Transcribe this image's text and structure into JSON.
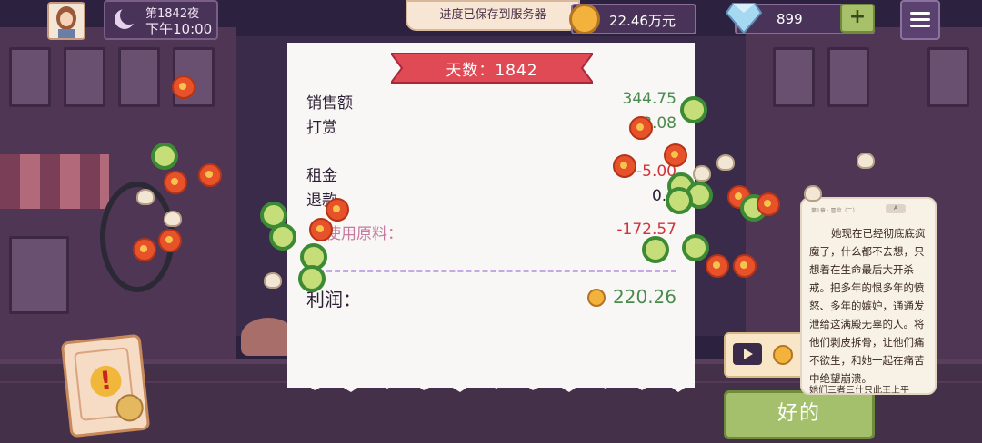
{
  "hud": {
    "day": "第1842夜",
    "time": "下午10:00",
    "save_toast": "进度已保存到服务器",
    "money": "22.46万元",
    "gems": "899",
    "plus": "+"
  },
  "receipt": {
    "banner": "天数：1842",
    "rows": [
      {
        "label": "销售额",
        "value": "344.75"
      },
      {
        "label": "打赏",
        "value": "8.08"
      },
      {
        "label": "租金",
        "value": "-5.00"
      },
      {
        "label": "退款",
        "value": "0.0"
      },
      {
        "label": "使用原料：",
        "value": "-172.57"
      }
    ],
    "profit_label": "利润：",
    "profit_value": "220.26"
  },
  "alert_icon": "!",
  "ok_button": "好的",
  "story": {
    "header": "第1章 · 冒险（二）",
    "tag": "A",
    "text": "她现在已经彻底底疯魔了，什么都不去想，只想着在生命最后大开杀戒。把多年的恨多年的愤怒、多年的嫉妒，通通发泄给这满殿无辜的人。将他们剥皮拆骨，让他们痛不欲生，和她一起在痛苦中绝望崩溃。",
    "tail": "她们三者三什只此王上平"
  },
  "icons": [
    "avatar-portrait",
    "moon-icon",
    "coin-icon",
    "diamond-icon",
    "plus-icon",
    "menu-icon",
    "alert-icon",
    "video-icon",
    "tomato-slice",
    "pepper-slice",
    "garlic-clove"
  ],
  "colors": {
    "positive": "#4b8a4e",
    "negative": "#d0343b",
    "banner": "#e04a55",
    "ok": "#a4c06c"
  }
}
